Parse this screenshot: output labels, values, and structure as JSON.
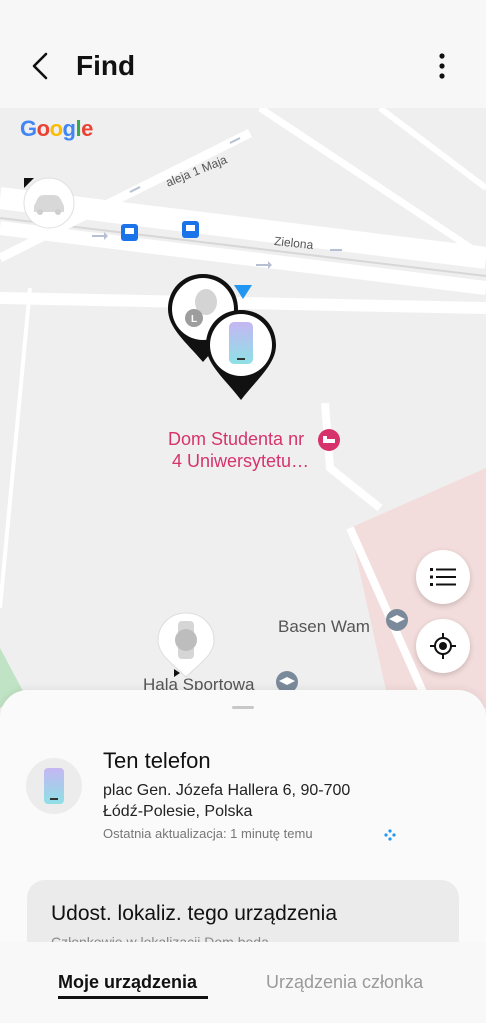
{
  "header": {
    "title": "Find"
  },
  "map": {
    "google_logo": [
      "G",
      "o",
      "o",
      "g",
      "l",
      "e"
    ],
    "google_colors": [
      "#4285F4",
      "#EA4335",
      "#FBBC05",
      "#4285F4",
      "#34A853",
      "#EA4335"
    ],
    "streets": [
      "aleja 1 Maja",
      "Zielona"
    ],
    "poi_pink": {
      "line1": "Dom Studenta nr",
      "line2": "4 Uniwersytetu…",
      "color": "#d6336c"
    },
    "poi_pool": "Basen Wam",
    "poi_hall": "Hala Sportowa"
  },
  "device": {
    "name": "Ten telefon",
    "address_line1": "plac Gen. Józefa Hallera 6, 90-700",
    "address_line2": "Łódź-Polesie, Polska",
    "update_text": "Ostatnia aktualizacja: 1 minutę temu"
  },
  "share": {
    "title": "Udost. lokaliz. tego urządzenia",
    "subtitle": "Członkowie w lokalizacji Dom będą"
  },
  "nav": {
    "tabs": [
      "Moje urządzenia",
      "Urządzenia członka"
    ]
  },
  "colors": {
    "accent": "#2196f3",
    "map_bg": "#efefef",
    "campus": "#f3dcdc",
    "park": "#bfe3c4"
  }
}
